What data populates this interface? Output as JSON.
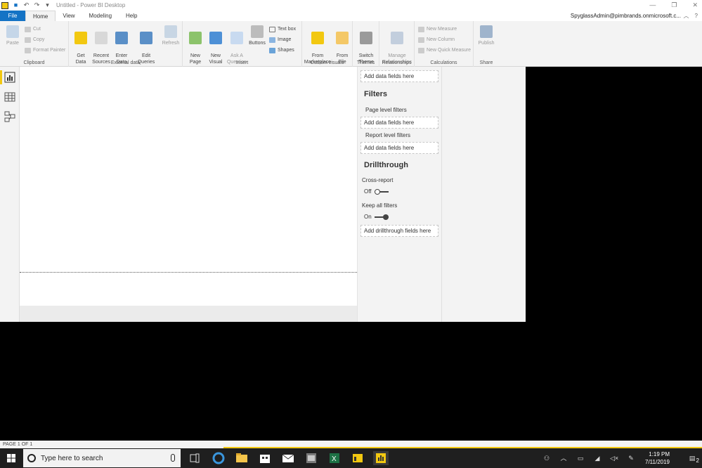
{
  "window": {
    "title": "Untitled - Power BI Desktop",
    "user": "SpyglassAdmin@pimbrands.onmicrosoft.c..."
  },
  "menu_tabs": [
    "File",
    "Home",
    "View",
    "Modeling",
    "Help"
  ],
  "ribbon": {
    "clipboard": {
      "label": "Clipboard",
      "paste": "Paste",
      "cut": "Cut",
      "copy": "Copy",
      "format_painter": "Format Painter"
    },
    "external_data": {
      "label": "External data",
      "get_data": "Get\nData",
      "recent_sources": "Recent\nSources",
      "enter_data": "Enter\nData",
      "edit_queries": "Edit\nQueries",
      "refresh": "Refresh"
    },
    "insert": {
      "label": "Insert",
      "new_page": "New\nPage",
      "new_visual": "New\nVisual",
      "ask_question": "Ask A\nQuestion",
      "buttons": "Buttons",
      "text_box": "Text box",
      "image": "Image",
      "shapes": "Shapes"
    },
    "custom_visuals": {
      "label": "Custom visuals",
      "from_marketplace": "From\nMarketplace",
      "from_file": "From\nFile"
    },
    "themes": {
      "label": "Themes",
      "switch_theme": "Switch\nTheme"
    },
    "relationships": {
      "label": "Relationships",
      "manage": "Manage\nRelationships"
    },
    "calculations": {
      "label": "Calculations",
      "new_measure": "New Measure",
      "new_column": "New Column",
      "new_quick_measure": "New Quick Measure"
    },
    "share": {
      "label": "Share",
      "publish": "Publish"
    }
  },
  "filters_pane": {
    "top_well": "Add data fields here",
    "filters_heading": "Filters",
    "page_level": "Page level filters",
    "page_well": "Add data fields here",
    "report_level": "Report level filters",
    "report_well": "Add data fields here",
    "drillthrough_heading": "Drillthrough",
    "cross_report": "Cross-report",
    "cross_report_state": "Off",
    "keep_all_filters": "Keep all filters",
    "keep_all_state": "On",
    "drillthrough_well": "Add drillthrough fields here"
  },
  "status": {
    "page_indicator": "PAGE 1 OF 1"
  },
  "taskbar": {
    "search_placeholder": "Type here to search",
    "time": "1:19 PM",
    "date": "7/11/2019",
    "notification_count": "2"
  },
  "colors": {
    "accent_yellow": "#f2c811",
    "file_tab_blue": "#1473c5",
    "taskbar": "#1f1f1f"
  }
}
